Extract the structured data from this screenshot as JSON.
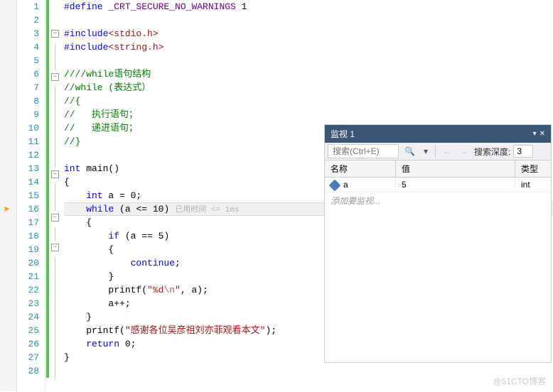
{
  "code": {
    "lines": [
      {
        "n": 1,
        "html": "<span class='kw'>#define</span> <span class='def'>_CRT_SECURE_NO_WARNINGS</span> 1"
      },
      {
        "n": 2,
        "html": ""
      },
      {
        "n": 3,
        "html": "<span class='kw'>#include</span><span class='str'>&lt;stdio.h&gt;</span>",
        "fold": "-"
      },
      {
        "n": 4,
        "html": "<span class='kw'>#include</span><span class='str'>&lt;string.h&gt;</span>"
      },
      {
        "n": 5,
        "html": ""
      },
      {
        "n": 6,
        "html": "<span class='cmt'>////while语句结构</span>",
        "fold": "-"
      },
      {
        "n": 7,
        "html": "<span class='cmt'>//while (表达式）</span>"
      },
      {
        "n": 8,
        "html": "<span class='cmt'>//{</span>"
      },
      {
        "n": 9,
        "html": "<span class='cmt'>//   执行语句；</span>"
      },
      {
        "n": 10,
        "html": "<span class='cmt'>//   递进语句；</span>"
      },
      {
        "n": 11,
        "html": "<span class='cmt'>//}</span>"
      },
      {
        "n": 12,
        "html": ""
      },
      {
        "n": 13,
        "html": "<span class='kw'>int</span> main()",
        "fold": "-"
      },
      {
        "n": 14,
        "html": "{"
      },
      {
        "n": 15,
        "html": "    <span class='kw'>int</span> a = 0;"
      },
      {
        "n": 16,
        "html": "    <span class='kw'>while</span> (a &lt;= 10)<span class='perf-hint'>已用时间 &lt;= 1ms</span>",
        "fold": "-",
        "current": true,
        "bp": true
      },
      {
        "n": 17,
        "html": "    {"
      },
      {
        "n": 18,
        "html": "        <span class='kw'>if</span> (a == 5)",
        "fold": "-"
      },
      {
        "n": 19,
        "html": "        {"
      },
      {
        "n": 20,
        "html": "            <span class='kw'>continue</span>;"
      },
      {
        "n": 21,
        "html": "        }"
      },
      {
        "n": 22,
        "html": "        printf(<span class='str'>\"%d<span class='esc'>\\n</span>\"</span>, a);"
      },
      {
        "n": 23,
        "html": "        a++;"
      },
      {
        "n": 24,
        "html": "    }"
      },
      {
        "n": 25,
        "html": "    printf(<span class='str'>\"感谢各位吴彦祖刘亦菲观看本文\"</span>);"
      },
      {
        "n": 26,
        "html": "    <span class='kw'>return</span> 0;"
      },
      {
        "n": 27,
        "html": "}"
      },
      {
        "n": 28,
        "html": ""
      }
    ]
  },
  "watch": {
    "title": "监视 1",
    "search_placeholder": "搜索(Ctrl+E)",
    "depth_label": "搜索深度:",
    "depth_value": "3",
    "columns": {
      "name": "名称",
      "value": "值",
      "type": "类型"
    },
    "rows": [
      {
        "name": "a",
        "value": "5",
        "type": "int"
      }
    ],
    "add_placeholder": "添加要监视..."
  },
  "watermark": "@51CTO博客"
}
